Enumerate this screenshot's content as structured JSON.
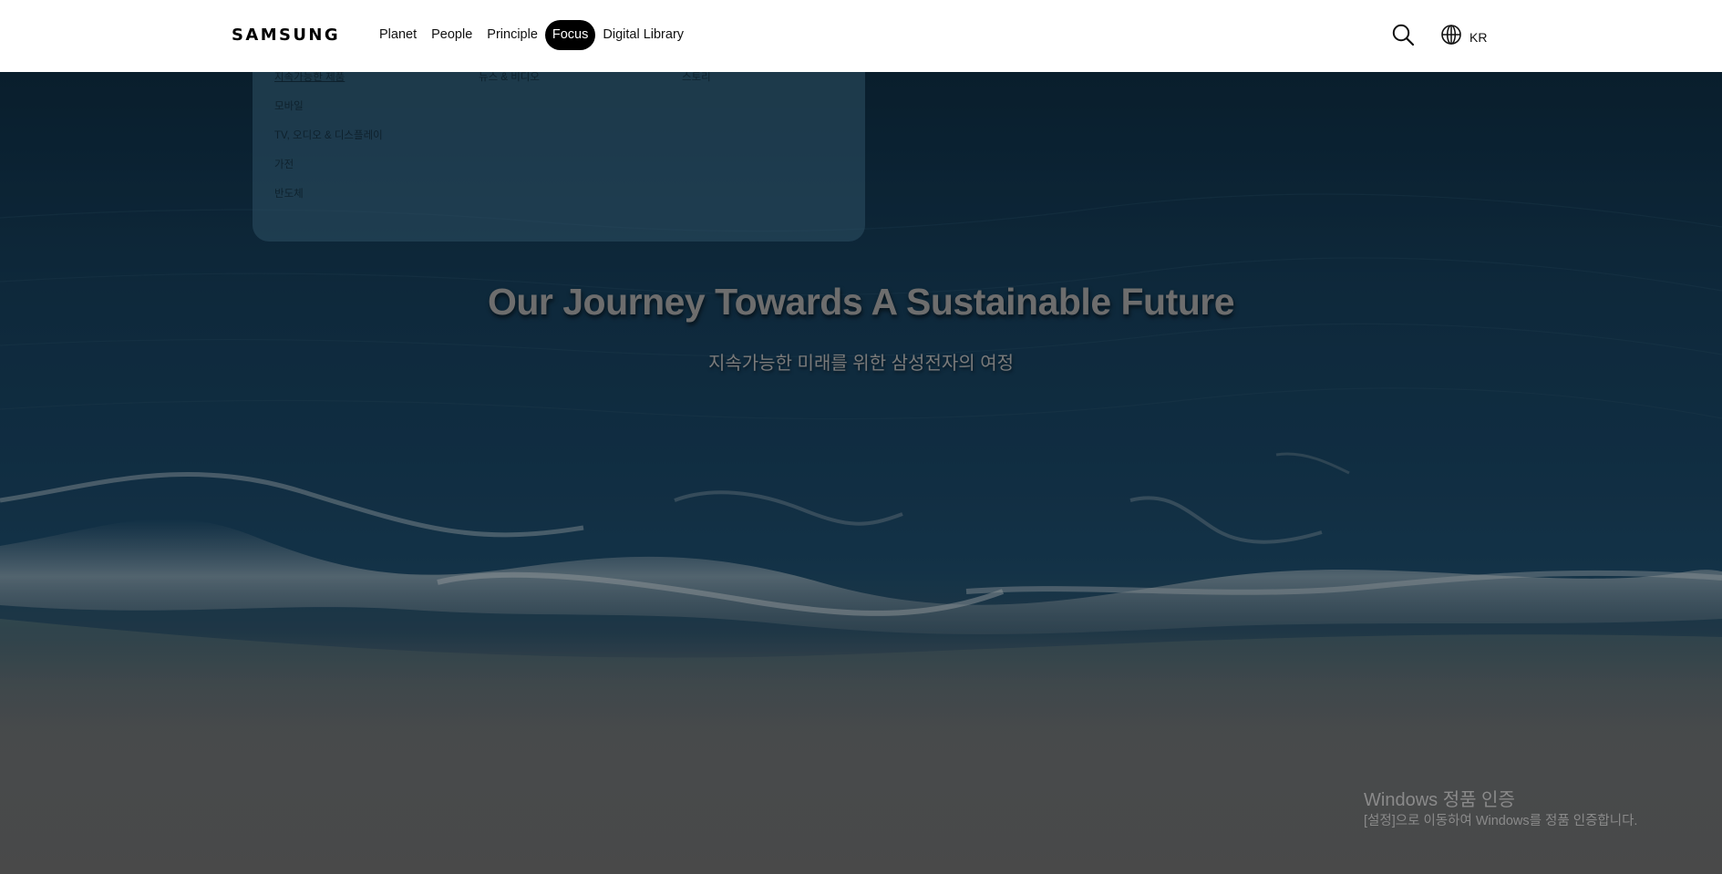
{
  "header": {
    "logo": "SAMSUNG",
    "nav": [
      {
        "label": "Planet"
      },
      {
        "label": "People"
      },
      {
        "label": "Principle"
      },
      {
        "label": "Focus"
      },
      {
        "label": "Digital Library"
      }
    ],
    "active_nav": "Focus",
    "search_icon": "search-icon",
    "language_icon": "globe-icon",
    "language_label": "KR"
  },
  "mega_menu": {
    "columns": [
      {
        "items": [
          "지속가능한 제품",
          "모바일",
          "TV, 오디오 & 디스플레이",
          "가전",
          "반도체"
        ]
      },
      {
        "items": [
          "뉴스 & 비디오"
        ]
      },
      {
        "items": [
          "스토리"
        ]
      }
    ]
  },
  "hero": {
    "title": "Our Journey Towards A Sustainable Future",
    "subtitle": "지속가능한 미래를 위한 삼성전자의 여정"
  },
  "windows_watermark": {
    "title": "Windows 정품 인증",
    "subtitle": "[설정]으로 이동하여 Windows를 정품 인증합니다."
  },
  "colors": {
    "header_bg": "#ffffff",
    "active_pill": "#000000",
    "ocean_dark": "#0d2a3e",
    "ocean_mid": "#1b4663",
    "sand": "#666666"
  }
}
